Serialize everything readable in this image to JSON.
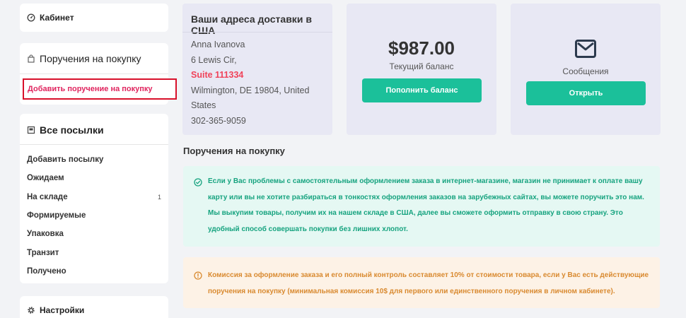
{
  "sidebar": {
    "cabinet": {
      "label": "Кабинет",
      "icon": "dashboard-icon"
    },
    "orders": {
      "title": "Поручения на покупку",
      "icon": "bag-icon",
      "add_link": "Добавить поручение на покупку"
    },
    "parcels": {
      "title": "Все посылки",
      "icon": "box-icon",
      "items": [
        {
          "label": "Добавить посылку",
          "count": ""
        },
        {
          "label": "Ожидаем",
          "count": ""
        },
        {
          "label": "На складе",
          "count": "1"
        },
        {
          "label": "Формируемые",
          "count": ""
        },
        {
          "label": "Упаковка",
          "count": ""
        },
        {
          "label": "Транзит",
          "count": ""
        },
        {
          "label": "Получено",
          "count": ""
        }
      ]
    },
    "settings": {
      "label": "Настройки",
      "icon": "gear-icon"
    }
  },
  "address": {
    "title": "Ваши адреса доставки в США",
    "name": "Anna Ivanova",
    "street": "6 Lewis Cir,",
    "suite": "Suite 111334",
    "city_line": "Wilmington, DE 19804, United States",
    "phone": "302-365-9059"
  },
  "balance": {
    "amount": "$987.00",
    "label": "Текущий баланс",
    "button": "Пополнить баланс"
  },
  "messages": {
    "icon": "envelope-icon",
    "label": "Сообщения",
    "button": "Открыть"
  },
  "section": {
    "title": "Поручения на покупку"
  },
  "alerts": {
    "info": {
      "icon": "check-circle-icon",
      "text": "Если у Вас проблемы с самостоятельным оформлением заказа в интернет-магазине, магазин не принимает к оплате вашу карту или вы не хотите разбираться в тонкостях оформления заказов на зарубежных сайтах, вы можете поручить это нам. Мы выкупим товары, получим их на нашем складе в США, далее вы сможете оформить отправку в свою страну. Это удобный способ совершать покупки без лишних хлопот."
    },
    "warning": {
      "icon": "info-circle-icon",
      "text": "Комиссия за оформление заказа и его полный контроль составляет 10% от стоимости товара, если у Вас есть действующие поручения на покупку (минимальная комиссия 10$ для первого или единственного поручения в личном кабинете)."
    }
  },
  "colors": {
    "accent_green": "#1bc09a",
    "link_pink": "#e0245e",
    "highlight_red": "#d8102a",
    "panel_bg": "#e8e8f4"
  }
}
